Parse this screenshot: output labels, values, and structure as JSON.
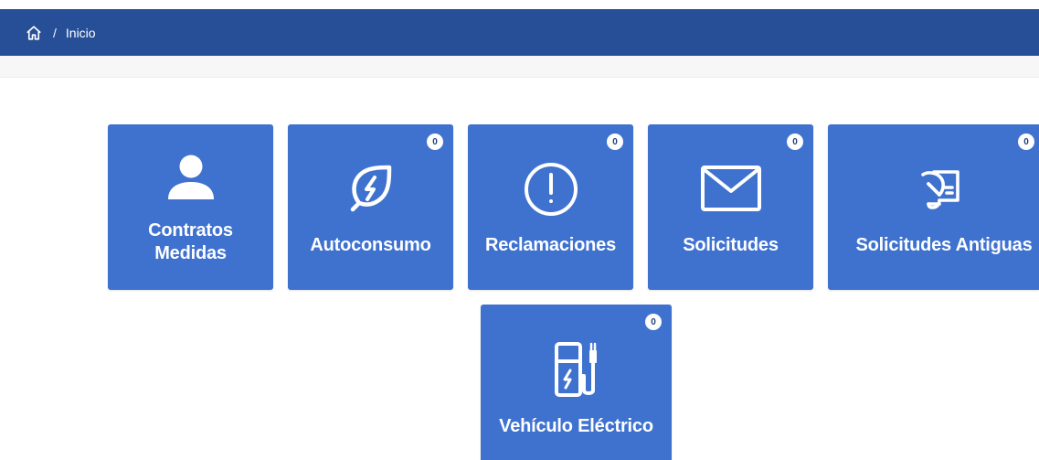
{
  "breadcrumb": {
    "home_icon": "home-icon",
    "separator": "/",
    "current": "Inicio"
  },
  "tiles": [
    {
      "label_line1": "Contratos",
      "label_line2": "Medidas",
      "icon": "user-icon"
    },
    {
      "label": "Autoconsumo",
      "badge": "0",
      "icon": "leaf-bolt-icon"
    },
    {
      "label": "Reclamaciones",
      "badge": "0",
      "icon": "exclamation-circle-icon"
    },
    {
      "label": "Solicitudes",
      "badge": "0",
      "icon": "envelope-icon"
    },
    {
      "label": "Solicitudes Antiguas",
      "badge": "0",
      "icon": "scroll-feather-icon"
    },
    {
      "label": "Vehículo Eléctrico",
      "badge": "0",
      "icon": "ev-charger-icon"
    }
  ],
  "colors": {
    "navbar": "#264f98",
    "tile": "#3f72cf",
    "badge_bg": "#ffffff",
    "text": "#ffffff"
  }
}
